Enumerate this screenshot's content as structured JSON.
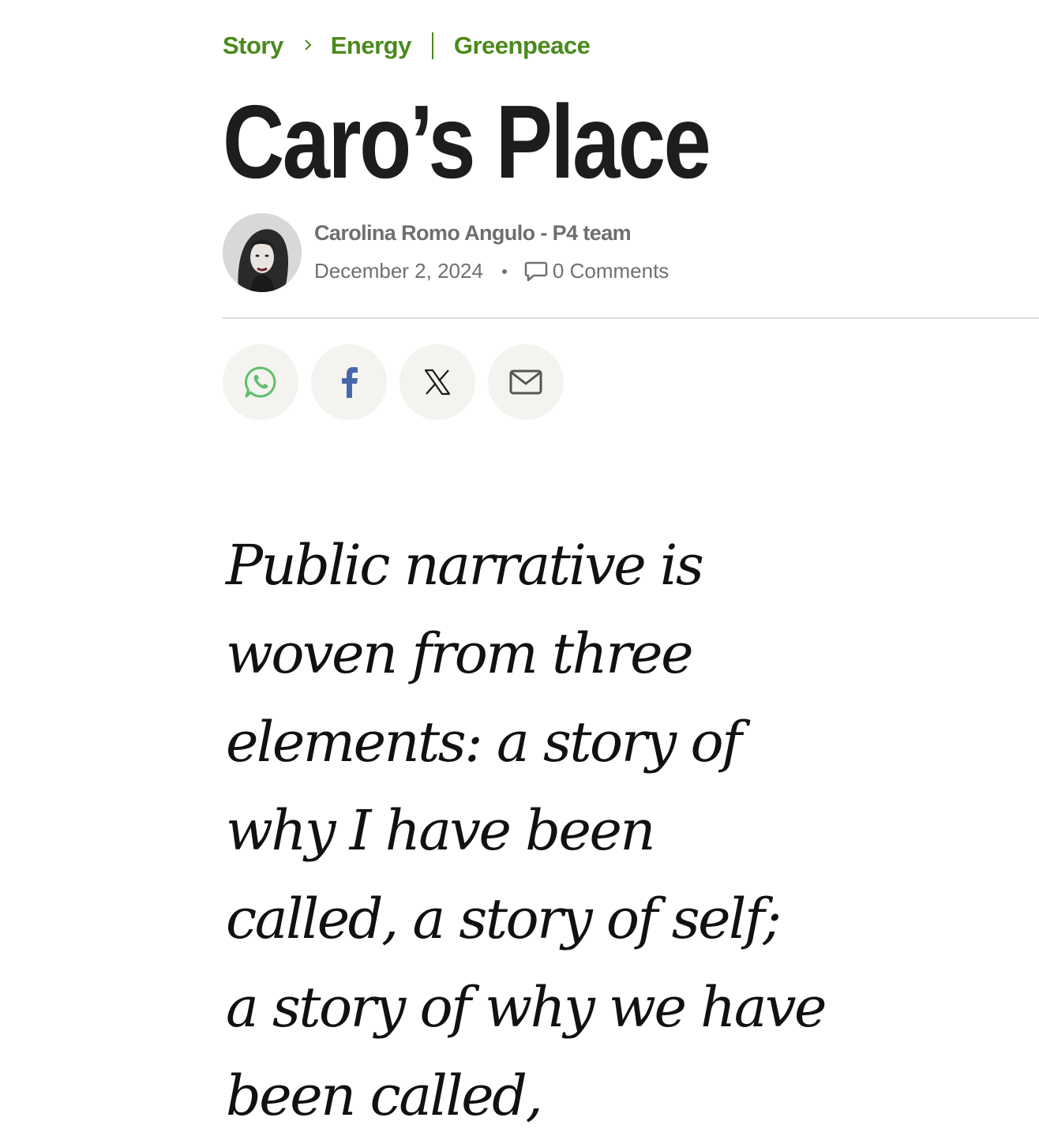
{
  "breadcrumb": {
    "items": [
      {
        "label": "Story"
      },
      {
        "label": "Energy"
      },
      {
        "label": "Greenpeace"
      }
    ]
  },
  "article": {
    "title": "Caro’s Place",
    "author_name": "Carolina Romo Angulo - P4 team",
    "date": "December 2, 2024",
    "comments_label": "0 Comments",
    "lead": "Public narrative is woven from three elements: a story of why I have been called, a story of self; a story of why we have been called,"
  },
  "share": {
    "buttons": [
      {
        "icon": "whatsapp-icon",
        "color": "#5fbf6c"
      },
      {
        "icon": "facebook-icon",
        "color": "#4867aa"
      },
      {
        "icon": "x-icon",
        "color": "#1a1a1a"
      },
      {
        "icon": "email-icon",
        "color": "#555555"
      }
    ]
  },
  "colors": {
    "accent": "#4a8a1c",
    "title": "#1d1d1d",
    "meta_text": "#707070",
    "share_bg": "#f4f3ef",
    "divider": "#dcdcdc"
  }
}
